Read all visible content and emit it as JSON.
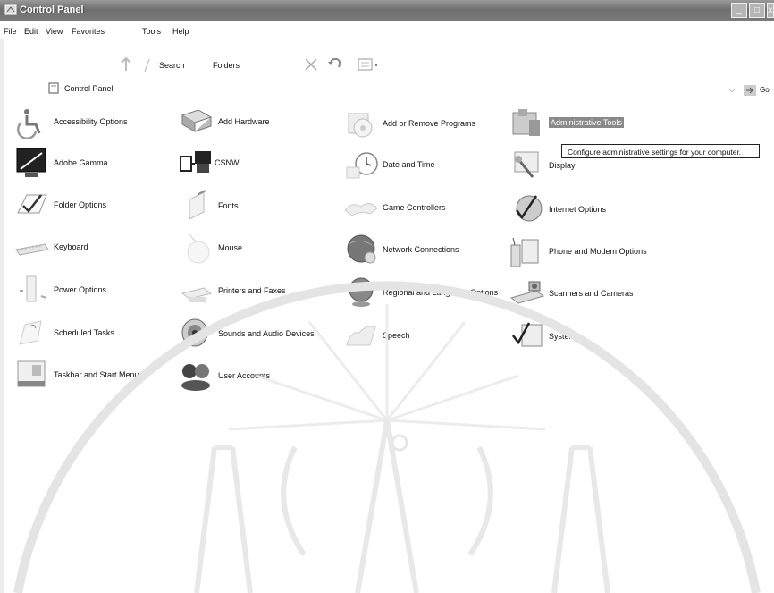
{
  "window": {
    "title": "Control Panel"
  },
  "menu": [
    "File",
    "Edit",
    "View",
    "Favorites",
    "Tools",
    "Help"
  ],
  "toolbar": {
    "search": "Search",
    "folders": "Folders"
  },
  "address": {
    "value": "Control Panel",
    "go": "Go"
  },
  "items": [
    {
      "label": "Accessibility Options",
      "icon": "accessibility-icon"
    },
    {
      "label": "Add Hardware",
      "icon": "add-hardware-icon"
    },
    {
      "label": "Add or Remove Programs",
      "icon": "add-remove-programs-icon"
    },
    {
      "label": "Administrative Tools",
      "icon": "administrative-tools-icon",
      "selected": true
    },
    {
      "label": "Adobe Gamma",
      "icon": "adobe-gamma-icon"
    },
    {
      "label": "CSNW",
      "icon": "csnw-icon"
    },
    {
      "label": "Date and Time",
      "icon": "date-time-icon"
    },
    {
      "label": "Display",
      "icon": "display-icon"
    },
    {
      "label": "Folder Options",
      "icon": "folder-options-icon"
    },
    {
      "label": "Fonts",
      "icon": "fonts-icon"
    },
    {
      "label": "Game Controllers",
      "icon": "game-controllers-icon"
    },
    {
      "label": "Internet Options",
      "icon": "internet-options-icon"
    },
    {
      "label": "Keyboard",
      "icon": "keyboard-icon"
    },
    {
      "label": "Mouse",
      "icon": "mouse-icon"
    },
    {
      "label": "Network Connections",
      "icon": "network-connections-icon"
    },
    {
      "label": "Phone and Modem Options",
      "icon": "phone-modem-icon"
    },
    {
      "label": "Power Options",
      "icon": "power-options-icon"
    },
    {
      "label": "Printers and Faxes",
      "icon": "printers-faxes-icon"
    },
    {
      "label": "Regional and Language Options",
      "icon": "regional-language-icon"
    },
    {
      "label": "Scanners and Cameras",
      "icon": "scanners-cameras-icon"
    },
    {
      "label": "Scheduled Tasks",
      "icon": "scheduled-tasks-icon"
    },
    {
      "label": "Sounds and Audio Devices",
      "icon": "sounds-audio-icon"
    },
    {
      "label": "Speech",
      "icon": "speech-icon"
    },
    {
      "label": "System",
      "icon": "system-icon"
    },
    {
      "label": "Taskbar and Start Menu",
      "icon": "taskbar-start-menu-icon"
    },
    {
      "label": "User Accounts",
      "icon": "user-accounts-icon"
    }
  ],
  "tooltip": "Configure administrative settings for your computer."
}
